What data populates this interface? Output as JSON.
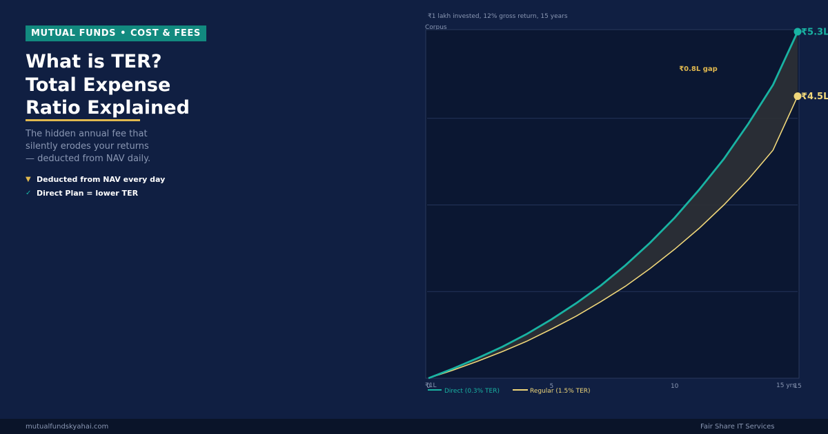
{
  "badge": {
    "left": "MUTUAL FUNDS",
    "sep": "•",
    "right": "COST & FEES"
  },
  "title": {
    "line1": "What is TER?",
    "line2": "Total Expense",
    "line3": "Ratio Explained"
  },
  "subtitle": {
    "line1": "The hidden annual fee that",
    "line2": "silently erodes your returns",
    "line3": "— deducted from NAV daily."
  },
  "bullets": [
    {
      "mark": "▼",
      "text": "Deducted from NAV every day"
    },
    {
      "mark": "✓",
      "text": "Direct Plan = lower TER"
    }
  ],
  "footer": {
    "site": "mutualfundskyahai.com",
    "company": "Fair Share IT Services"
  },
  "colors": {
    "accent_teal": "#19b3a3",
    "accent_gold": "#e0b84f",
    "background": "#101f42",
    "plot_bg": "#0b1732"
  },
  "chart_data": {
    "type": "line",
    "subtitle": "₹1 lakh invested, 12% gross return, 15 years",
    "ylabel": "Corpus",
    "xlim": [
      0,
      15
    ],
    "ylim": [
      1,
      5.3
    ],
    "x_ticks": [
      "0",
      "5",
      "10",
      "15"
    ],
    "x_end_label": "15 yrs",
    "y_start_label": "₹1L",
    "grid": true,
    "legend_position": "bottom-left",
    "x": [
      0,
      1,
      2,
      3,
      4,
      5,
      6,
      7,
      8,
      9,
      10,
      11,
      12,
      13,
      14,
      15
    ],
    "series": [
      {
        "name": "Direct (0.3% TER)",
        "color": "#19b3a3",
        "values": [
          1.0,
          1.12,
          1.25,
          1.39,
          1.55,
          1.73,
          1.93,
          2.15,
          2.4,
          2.68,
          2.99,
          3.34,
          3.72,
          4.16,
          4.64,
          5.3
        ],
        "end_label": "₹5.3L"
      },
      {
        "name": "Regular (1.5% TER)",
        "color": "#f0d77a",
        "values": [
          1.0,
          1.1,
          1.21,
          1.33,
          1.46,
          1.61,
          1.77,
          1.95,
          2.14,
          2.36,
          2.6,
          2.86,
          3.15,
          3.47,
          3.83,
          4.5
        ],
        "end_label": "₹4.5L"
      }
    ],
    "annotation": "₹0.8L gap"
  }
}
